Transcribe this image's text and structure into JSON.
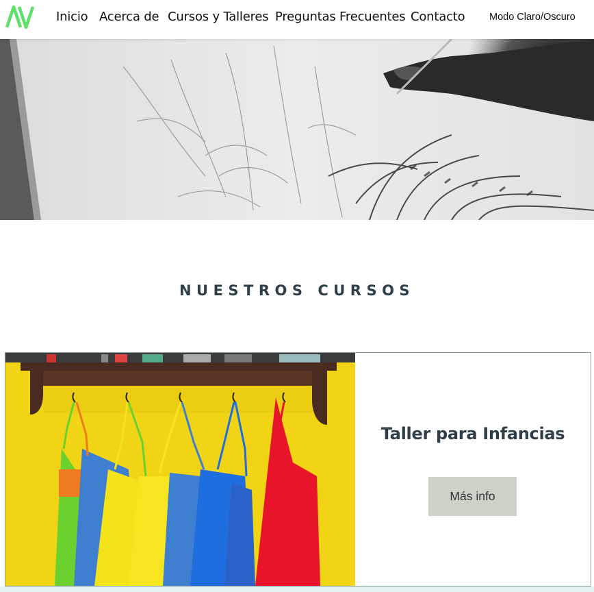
{
  "header": {
    "logo_alt": "AV",
    "nav": [
      {
        "label": "Inicio"
      },
      {
        "label": "Acerca de"
      },
      {
        "label": "Cursos y Talleres"
      },
      {
        "label": "Preguntas Frecuentes"
      },
      {
        "label": "Contacto"
      }
    ],
    "mode_toggle_label": "Modo Claro/Oscuro"
  },
  "hero": {
    "image": "drawing-hand-botanical-sketch"
  },
  "section": {
    "title": "NUESTROS CURSOS"
  },
  "courses": [
    {
      "title": "Taller para Infancias",
      "button_label": "Más info",
      "image": "colorful-aprons-on-hooks"
    }
  ],
  "colors": {
    "logo_green": "#5fe06a",
    "heading": "#2f3f48",
    "button_bg": "#cbd2c8",
    "card_border": "#8a9ea2"
  }
}
